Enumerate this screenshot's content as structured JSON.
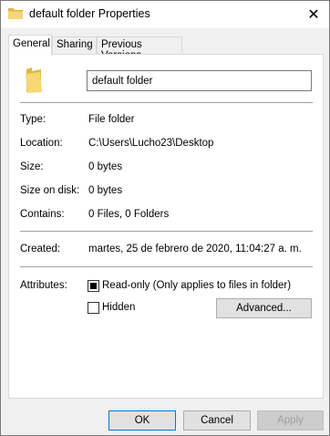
{
  "window": {
    "title": "default folder Properties",
    "close_glyph": "✕"
  },
  "tabs": [
    {
      "label": "General",
      "active": true
    },
    {
      "label": "Sharing",
      "active": false
    },
    {
      "label": "Previous Versions",
      "active": false
    }
  ],
  "general": {
    "name_value": "default folder",
    "rows": [
      {
        "label": "Type:",
        "value": "File folder"
      },
      {
        "label": "Location:",
        "value": "C:\\Users\\Lucho23\\Desktop"
      },
      {
        "label": "Size:",
        "value": "0 bytes"
      },
      {
        "label": "Size on disk:",
        "value": "0 bytes"
      },
      {
        "label": "Contains:",
        "value": "0 Files, 0 Folders"
      }
    ],
    "created_label": "Created:",
    "created_value": "martes, 25 de febrero de 2020, 11:04:27 a. m.",
    "attributes_label": "Attributes:",
    "readonly_label": "Read-only (Only applies to files in folder)",
    "readonly_state": "indeterminate",
    "hidden_label": "Hidden",
    "hidden_checked": false,
    "advanced_label": "Advanced..."
  },
  "footer": {
    "ok_label": "OK",
    "cancel_label": "Cancel",
    "apply_label": "Apply"
  },
  "colors": {
    "folder_yellow": "#f7d674",
    "folder_dark": "#e0b543",
    "accent": "#0078d7"
  }
}
